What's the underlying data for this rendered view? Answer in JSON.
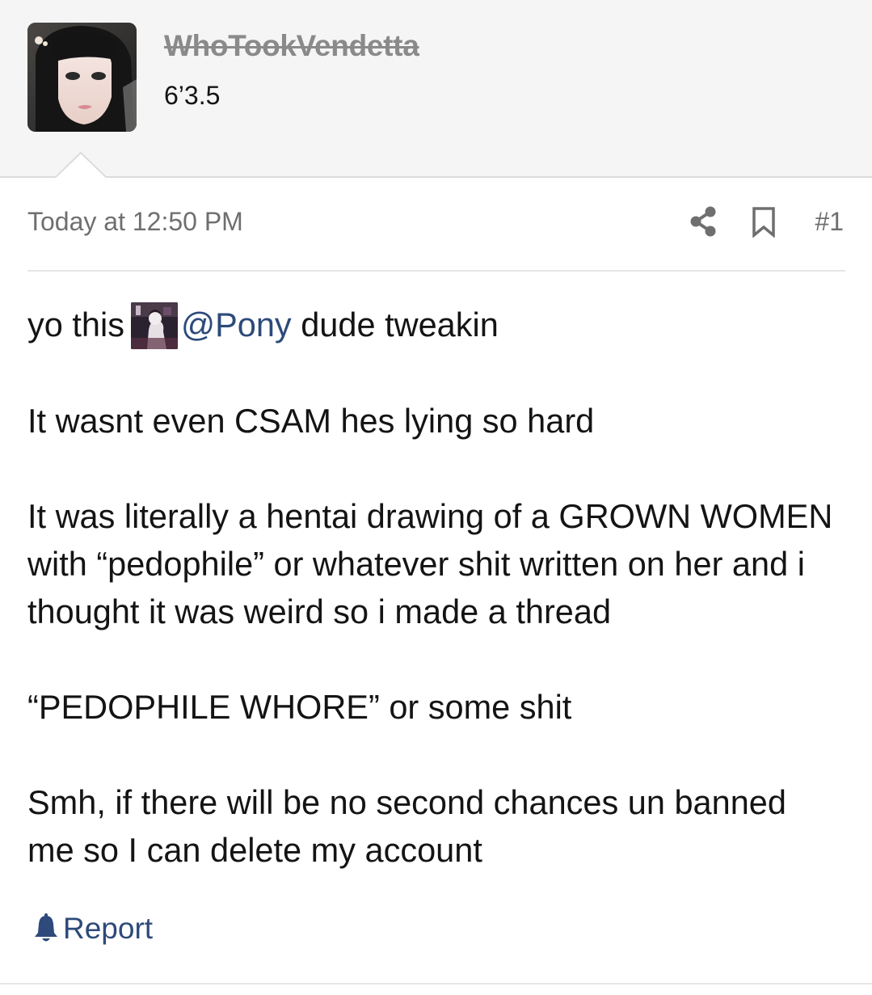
{
  "user": {
    "username": "WhoTookVendetta",
    "title": "6’3.5"
  },
  "post": {
    "date": "Today at 12:50 PM",
    "number": "#1",
    "line1_before": "yo this",
    "mention": "@Pony",
    "line1_after": "dude tweakin",
    "paragraphs": [
      "It wasnt even CSAM hes lying so hard",
      "It was literally a hentai drawing of a GROWN WOMEN with “pedophile” or whatever shit written on her and i thought it was weird so i made a thread",
      "“PEDOPHILE WHORE” or some shit",
      "Smh, if there will be no second chances un banned me so I can delete my account"
    ]
  },
  "actions": {
    "report_label": "Report"
  },
  "icons": {
    "share": "share-icon",
    "bookmark": "bookmark-icon",
    "report": "bell-icon"
  },
  "colors": {
    "link": "#2d4a7a",
    "muted": "#6f6f6f",
    "header_bg": "#f5f5f5"
  }
}
